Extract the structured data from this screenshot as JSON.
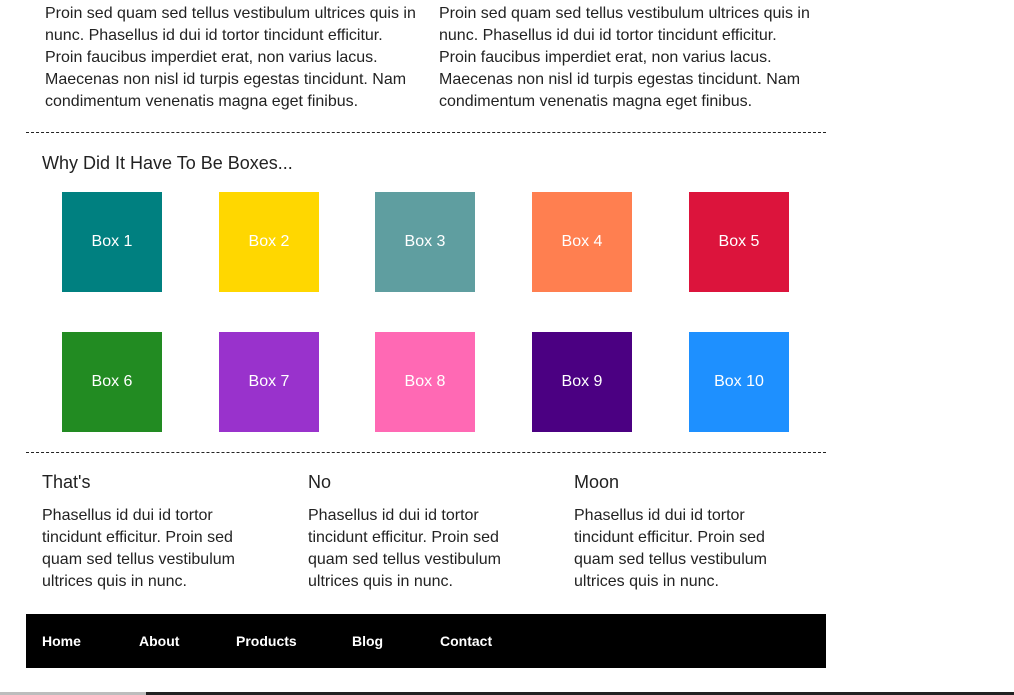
{
  "top_paragraphs": [
    "Proin sed quam sed tellus vestibulum ultrices quis in nunc. Phasellus id dui id tortor tincidunt efficitur. Proin faucibus imperdiet erat, non varius lacus. Maecenas non nisl id turpis egestas tincidunt. Nam condimentum venenatis magna eget finibus.",
    "Proin sed quam sed tellus vestibulum ultrices quis in nunc. Phasellus id dui id tortor tincidunt efficitur. Proin faucibus imperdiet erat, non varius lacus. Maecenas non nisl id turpis egestas tincidunt. Nam condimentum venenatis magna eget finibus."
  ],
  "boxes": {
    "heading": "Why Did It Have To Be Boxes...",
    "items": [
      {
        "label": "Box 1",
        "color": "#008080"
      },
      {
        "label": "Box 2",
        "color": "#FFD700"
      },
      {
        "label": "Box 3",
        "color": "#5F9EA0"
      },
      {
        "label": "Box 4",
        "color": "#FF7F50"
      },
      {
        "label": "Box 5",
        "color": "#DC143C"
      },
      {
        "label": "Box 6",
        "color": "#228B22"
      },
      {
        "label": "Box 7",
        "color": "#9932CC"
      },
      {
        "label": "Box 8",
        "color": "#FF69B4"
      },
      {
        "label": "Box 9",
        "color": "#4B0082"
      },
      {
        "label": "Box 10",
        "color": "#1E90FF"
      }
    ]
  },
  "features": [
    {
      "title": "That's",
      "text": "Phasellus id dui id tortor tincidunt efficitur. Proin sed quam sed tellus vestibulum ultrices quis in nunc."
    },
    {
      "title": "No",
      "text": "Phasellus id dui id tortor tincidunt efficitur. Proin sed quam sed tellus vestibulum ultrices quis in nunc."
    },
    {
      "title": "Moon",
      "text": "Phasellus id dui id tortor tincidunt efficitur. Proin sed quam sed tellus vestibulum ultrices quis in nunc."
    }
  ],
  "nav": {
    "items": [
      "Home",
      "About",
      "Products",
      "Blog",
      "Contact"
    ]
  }
}
